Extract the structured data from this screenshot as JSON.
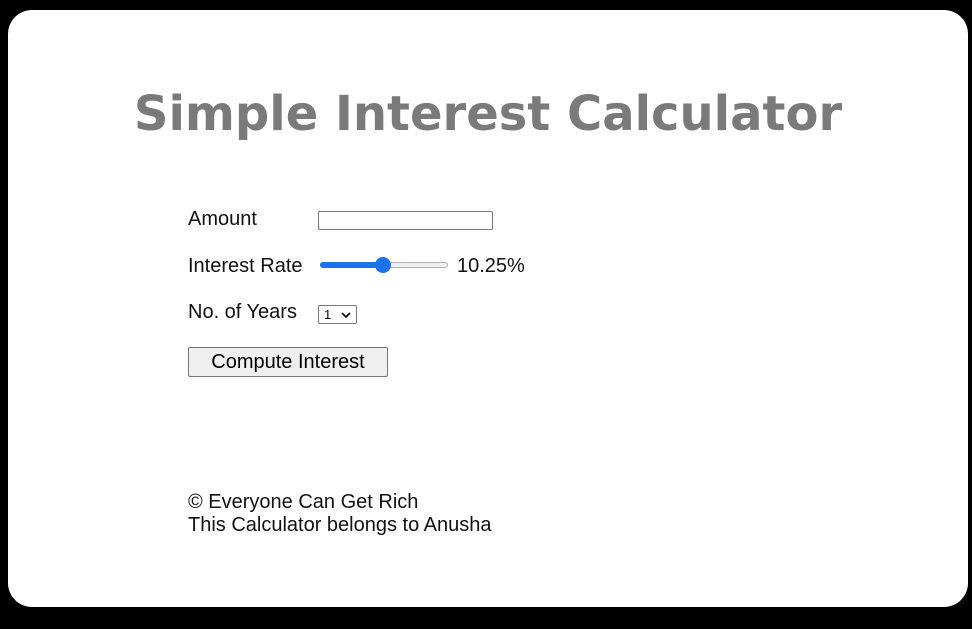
{
  "header": {
    "title": "Simple Interest Calculator"
  },
  "form": {
    "amount": {
      "label": "Amount",
      "value": "",
      "placeholder": ""
    },
    "interest_rate": {
      "label": "Interest Rate",
      "display": "10.25%",
      "value": 10.25,
      "min": 1,
      "max": 20
    },
    "years": {
      "label": "No. of Years",
      "selected": "1"
    },
    "compute_label": "Compute Interest"
  },
  "footer": {
    "copyright": "© Everyone Can Get Rich",
    "owner": "This Calculator belongs to Anusha"
  },
  "colors": {
    "background": "#000000",
    "card": "#ffffff",
    "title": "#7a7a7a",
    "accent": "#1a73e8"
  },
  "icons": {
    "select_arrow": "chevron-down-icon"
  }
}
